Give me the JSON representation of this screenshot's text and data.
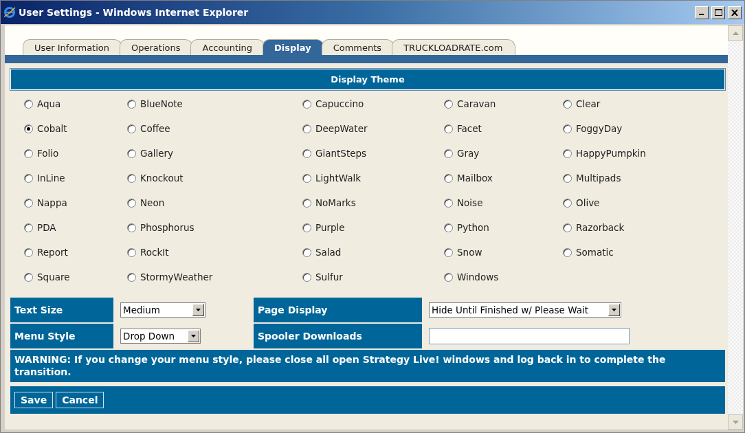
{
  "window": {
    "title": "User Settings - Windows Internet Explorer"
  },
  "tabs": [
    {
      "label": "User Information",
      "selected": false
    },
    {
      "label": "Operations",
      "selected": false
    },
    {
      "label": "Accounting",
      "selected": false
    },
    {
      "label": "Display",
      "selected": true
    },
    {
      "label": "Comments",
      "selected": false
    },
    {
      "label": "TRUCKLOADRATE.com",
      "selected": false
    }
  ],
  "theme_section": {
    "title": "Display Theme",
    "themes": [
      {
        "label": "Aqua",
        "selected": false
      },
      {
        "label": "BlueNote",
        "selected": false
      },
      {
        "label": "Capuccino",
        "selected": false
      },
      {
        "label": "Caravan",
        "selected": false
      },
      {
        "label": "Clear",
        "selected": false
      },
      {
        "label": "Cobalt",
        "selected": true
      },
      {
        "label": "Coffee",
        "selected": false
      },
      {
        "label": "DeepWater",
        "selected": false
      },
      {
        "label": "Facet",
        "selected": false
      },
      {
        "label": "FoggyDay",
        "selected": false
      },
      {
        "label": "Folio",
        "selected": false
      },
      {
        "label": "Gallery",
        "selected": false
      },
      {
        "label": "GiantSteps",
        "selected": false
      },
      {
        "label": "Gray",
        "selected": false
      },
      {
        "label": "HappyPumpkin",
        "selected": false
      },
      {
        "label": "InLine",
        "selected": false
      },
      {
        "label": "Knockout",
        "selected": false
      },
      {
        "label": "LightWalk",
        "selected": false
      },
      {
        "label": "Mailbox",
        "selected": false
      },
      {
        "label": "Multipads",
        "selected": false
      },
      {
        "label": "Nappa",
        "selected": false
      },
      {
        "label": "Neon",
        "selected": false
      },
      {
        "label": "NoMarks",
        "selected": false
      },
      {
        "label": "Noise",
        "selected": false
      },
      {
        "label": "Olive",
        "selected": false
      },
      {
        "label": "PDA",
        "selected": false
      },
      {
        "label": "Phosphorus",
        "selected": false
      },
      {
        "label": "Purple",
        "selected": false
      },
      {
        "label": "Python",
        "selected": false
      },
      {
        "label": "Razorback",
        "selected": false
      },
      {
        "label": "Report",
        "selected": false
      },
      {
        "label": "RockIt",
        "selected": false
      },
      {
        "label": "Salad",
        "selected": false
      },
      {
        "label": "Snow",
        "selected": false
      },
      {
        "label": "Somatic",
        "selected": false
      },
      {
        "label": "Square",
        "selected": false
      },
      {
        "label": "StormyWeather",
        "selected": false
      },
      {
        "label": "Sulfur",
        "selected": false
      },
      {
        "label": "Windows",
        "selected": false
      }
    ]
  },
  "settings": [
    {
      "label": "Text Size",
      "kind": "select",
      "value": "Medium"
    },
    {
      "label": "Page Display",
      "kind": "select",
      "value": "Hide Until Finished w/ Please Wait"
    },
    {
      "label": "Menu Style",
      "kind": "select",
      "value": "Drop Down"
    },
    {
      "label": "Spooler Downloads",
      "kind": "input"
    }
  ],
  "warning": "WARNING: If you change your menu style, please close all open Strategy Live! windows and log back in to complete the transition.",
  "buttons": [
    "Save",
    "Cancel"
  ]
}
